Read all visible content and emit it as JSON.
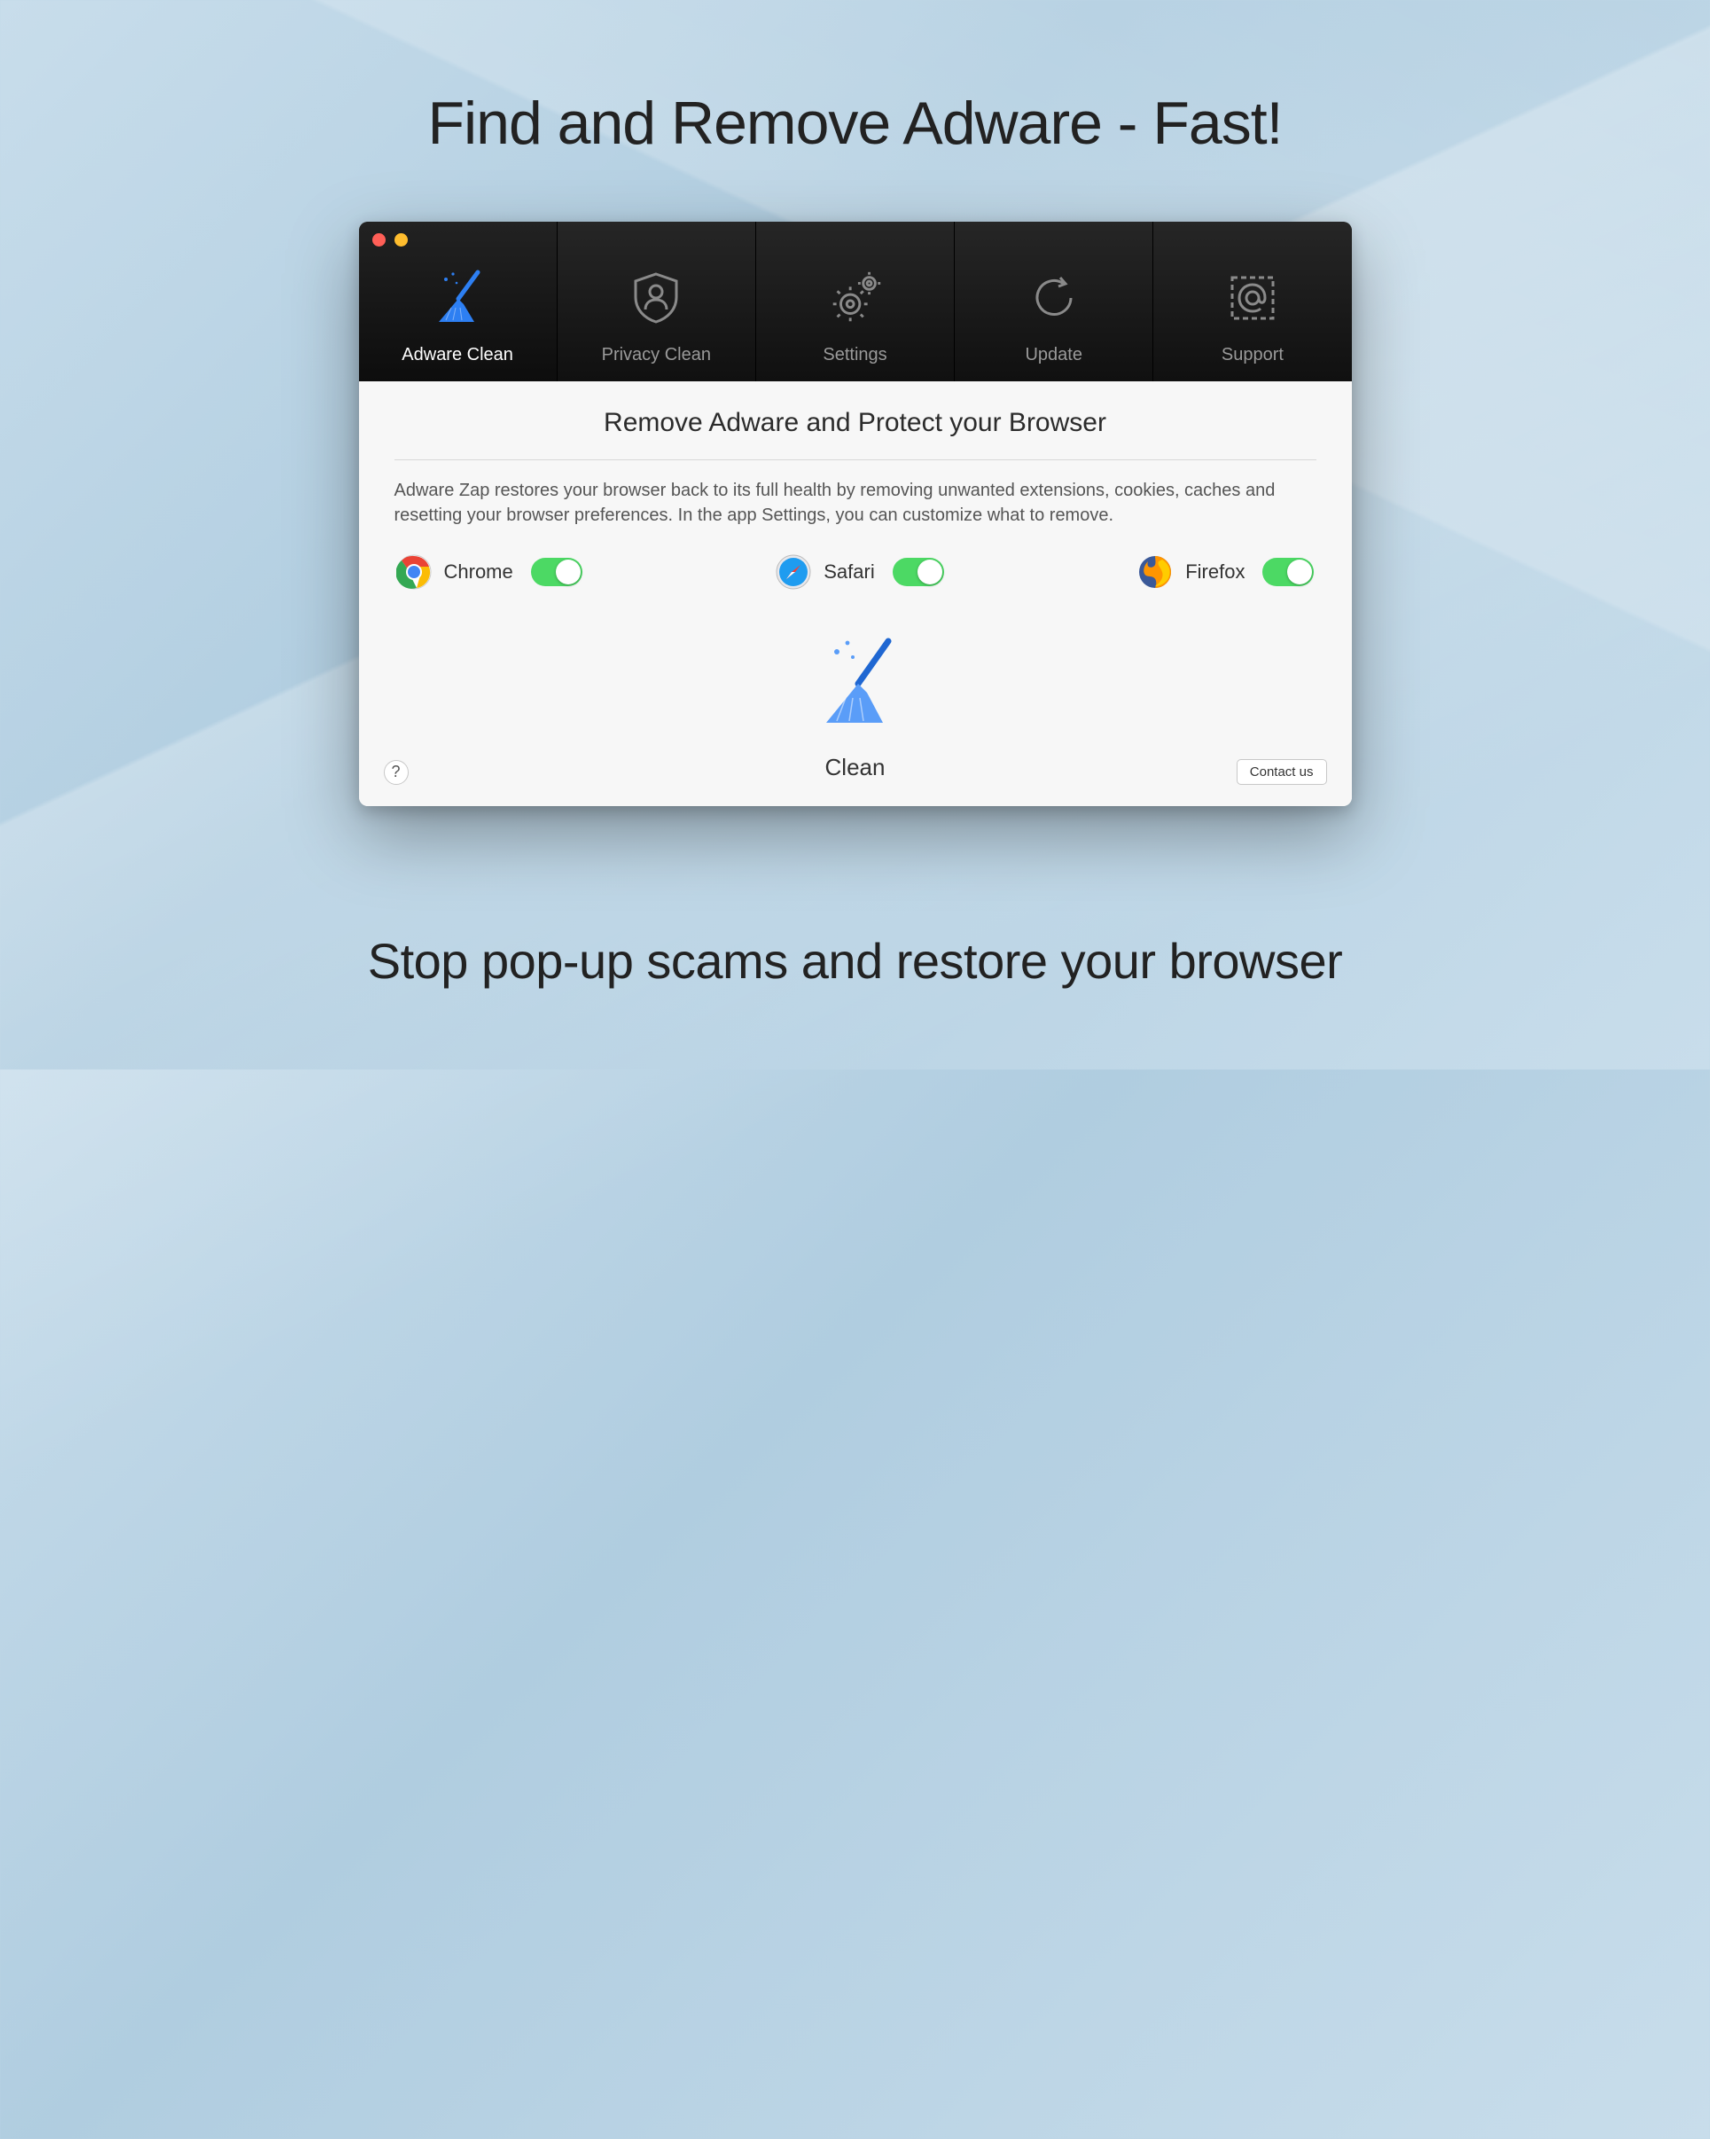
{
  "marketing": {
    "headline": "Find and Remove Adware - Fast!",
    "subline": "Stop pop-up scams and restore your browser"
  },
  "tabs": [
    {
      "label": "Adware Clean",
      "active": true
    },
    {
      "label": "Privacy Clean",
      "active": false
    },
    {
      "label": "Settings",
      "active": false
    },
    {
      "label": "Update",
      "active": false
    },
    {
      "label": "Support",
      "active": false
    }
  ],
  "pane": {
    "title": "Remove Adware and Protect your Browser",
    "description": "Adware Zap restores your browser back to its full health by removing unwanted extensions, cookies, caches and resetting your browser preferences. In the app Settings, you can customize what to remove.",
    "browsers": [
      {
        "name": "Chrome",
        "enabled": true
      },
      {
        "name": "Safari",
        "enabled": true
      },
      {
        "name": "Firefox",
        "enabled": true
      }
    ],
    "clean_label": "Clean",
    "help_label": "?",
    "contact_label": "Contact us"
  }
}
